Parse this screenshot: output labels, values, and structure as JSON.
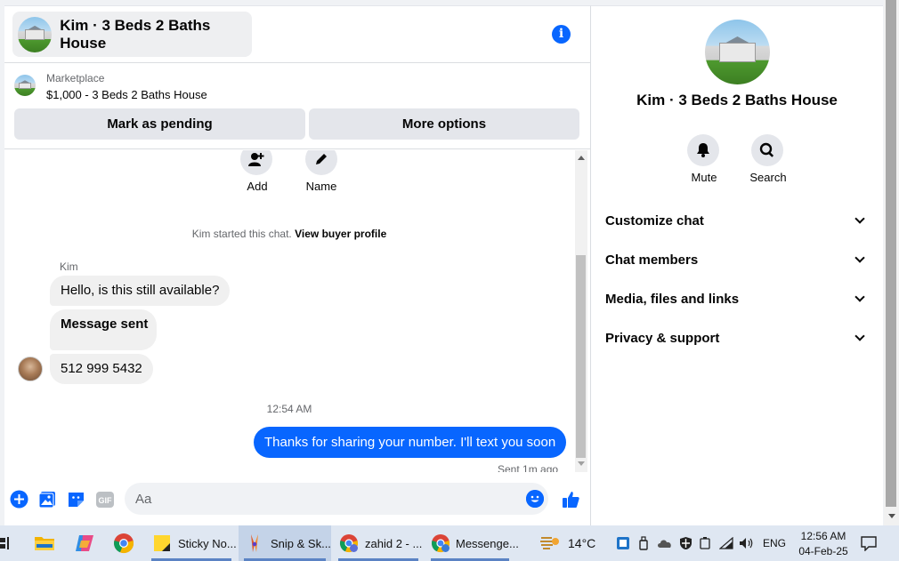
{
  "chat": {
    "title": "Kim · 3 Beds 2 Baths House",
    "listing": {
      "label": "Marketplace",
      "title": "$1,000 - 3 Beds 2 Baths House",
      "mark_pending": "Mark as pending",
      "more_options": "More options"
    },
    "actions": {
      "add": "Add",
      "name": "Name"
    },
    "system": {
      "started": "Kim started this chat.",
      "link": "View buyer profile"
    },
    "sender": "Kim",
    "messages_in": [
      "Hello, is this still available?",
      "Message sent",
      "512 999 5432"
    ],
    "timestamp": "12:54 AM",
    "message_out": "Thanks for sharing your number. I'll text you soon",
    "sent_status": "Sent 1m ago",
    "composer": {
      "placeholder": "Aa",
      "gif": "GIF"
    }
  },
  "info": {
    "title": "Kim · 3 Beds 2 Baths House",
    "mute": "Mute",
    "search": "Search",
    "sections": [
      "Customize chat",
      "Chat members",
      "Media, files and links",
      "Privacy & support"
    ]
  },
  "taskbar": {
    "apps": [
      "Sticky No...",
      "Snip & Sk...",
      "zahid 2 - ...",
      "Messenge..."
    ],
    "weather": "14°C",
    "lang": "ENG",
    "time": "12:56 AM",
    "date": "04-Feb-25"
  },
  "colors": {
    "accent": "#0866ff",
    "bubble_in": "#f0f0f0",
    "button_gray": "#e4e6eb"
  }
}
